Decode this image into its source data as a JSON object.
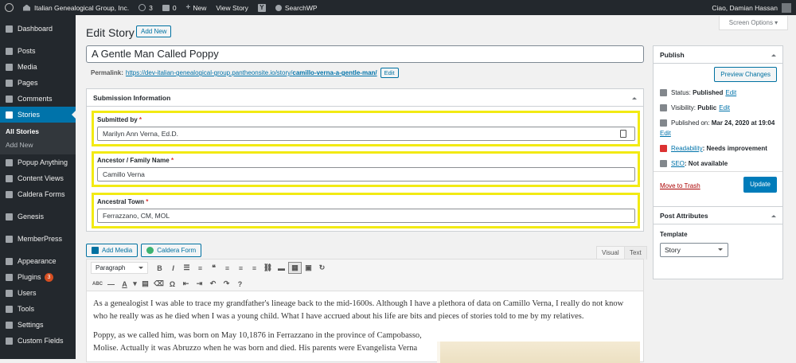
{
  "adminbar": {
    "site_name": "Italian Genealogical Group, Inc.",
    "updates_count": "3",
    "comments_count": "0",
    "new_label": "New",
    "view_story_label": "View Story",
    "yoast_label": "Y",
    "searchwp_label": "SearchWP",
    "greeting": "Ciao, Damian Hassan"
  },
  "sidebar": {
    "items": [
      {
        "label": "Dashboard"
      },
      {
        "label": "Posts"
      },
      {
        "label": "Media"
      },
      {
        "label": "Pages"
      },
      {
        "label": "Comments"
      },
      {
        "label": "Stories"
      },
      {
        "label": "Popup Anything"
      },
      {
        "label": "Content Views"
      },
      {
        "label": "Caldera Forms"
      },
      {
        "label": "Genesis"
      },
      {
        "label": "MemberPress"
      },
      {
        "label": "Appearance"
      },
      {
        "label": "Plugins"
      },
      {
        "label": "Users"
      },
      {
        "label": "Tools"
      },
      {
        "label": "Settings"
      },
      {
        "label": "Custom Fields"
      }
    ],
    "sub_items": [
      {
        "label": "All Stories"
      },
      {
        "label": "Add New"
      }
    ],
    "plugins_badge": "3"
  },
  "header": {
    "screen_options": "Screen Options",
    "title": "Edit Story",
    "add_new": "Add New"
  },
  "post": {
    "title": "A Gentle Man Called Poppy",
    "permalink_label": "Permalink:",
    "permalink_base": "https://dev-italian-genealogical-group.pantheonsite.io/story/",
    "permalink_slug": "camillo-verna-a-gentle-man/",
    "edit_label": "Edit"
  },
  "submission": {
    "heading": "Submission Information",
    "fields": [
      {
        "label": "Submitted by",
        "required": "*",
        "value": "Marilyn Ann Verna, Ed.D."
      },
      {
        "label": "Ancestor / Family Name",
        "required": "*",
        "value": "Camillo Verna"
      },
      {
        "label": "Ancestral Town",
        "required": "*",
        "value": "Ferrazzano, CM, MOL"
      }
    ]
  },
  "editor": {
    "add_media": "Add Media",
    "caldera_form": "Caldera Form",
    "tab_visual": "Visual",
    "tab_text": "Text",
    "format_select": "Paragraph",
    "paragraphs": [
      "As a genealogist I was able to trace my grandfather's lineage back to the mid-1600s.  Although I have a plethora of data on Camillo Verna, I really do not know who he really was as he died when I was a young child.  What I have accrued about his life are bits and pieces of stories told to me by my relatives.",
      "Poppy, as we called him, was born on May 10,1876 in Ferrazzano in the province of Campobasso, Molise.  Actually it was Abruzzo when he was born and died.  His parents were Evangelista Verna"
    ]
  },
  "publish": {
    "heading": "Publish",
    "preview": "Preview Changes",
    "status_label": "Status:",
    "status_value": "Published",
    "visibility_label": "Visibility:",
    "visibility_value": "Public",
    "published_label": "Published on:",
    "published_value": "Mar 24, 2020 at 19:04",
    "readability_link": "Readability",
    "readability_value": ": Needs improvement",
    "seo_link": "SEO",
    "seo_value": ": Not available",
    "edit": "Edit",
    "trash": "Move to Trash",
    "update": "Update"
  },
  "attributes": {
    "heading": "Post Attributes",
    "template_label": "Template",
    "template_value": "Story"
  }
}
